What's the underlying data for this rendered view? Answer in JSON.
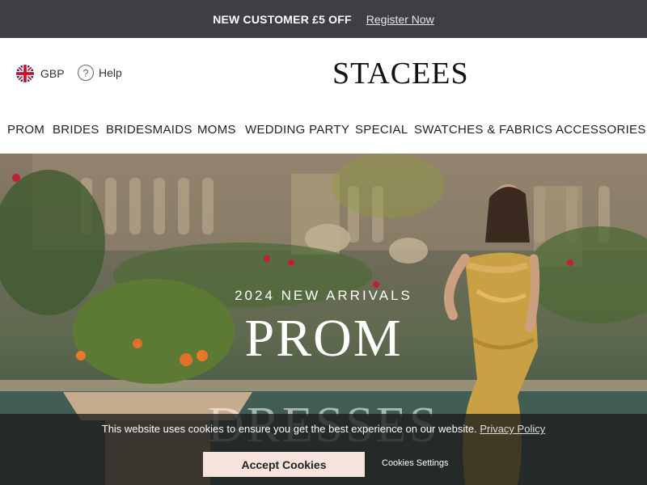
{
  "promo": {
    "offer": "NEW CUSTOMER £5 OFF",
    "register": "Register Now"
  },
  "header": {
    "currency": "GBP",
    "currency_flag": "uk-flag-icon",
    "help": "Help",
    "help_icon": "question-circle-icon",
    "logo": "STACEES"
  },
  "nav": [
    "PROM",
    "BRIDES",
    "BRIDESMAIDS",
    "MOMS",
    "WEDDING PARTY",
    "SPECIAL",
    "SWATCHES & FABRICS",
    "ACCESSORIES &"
  ],
  "hero": {
    "kicker": "2024 NEW ARRIVALS",
    "title": "PROM",
    "subtitle": "DRESSES"
  },
  "cookie": {
    "message": "This website uses cookies to ensure you get the best experience on our website.",
    "policy_link": "Privacy Policy",
    "accept": "Accept Cookies",
    "settings": "Cookies Settings"
  },
  "colors": {
    "promo_bar": "#3d3f44",
    "accept_button": "#f6e3dc",
    "dress_gold": "#c9a044"
  }
}
